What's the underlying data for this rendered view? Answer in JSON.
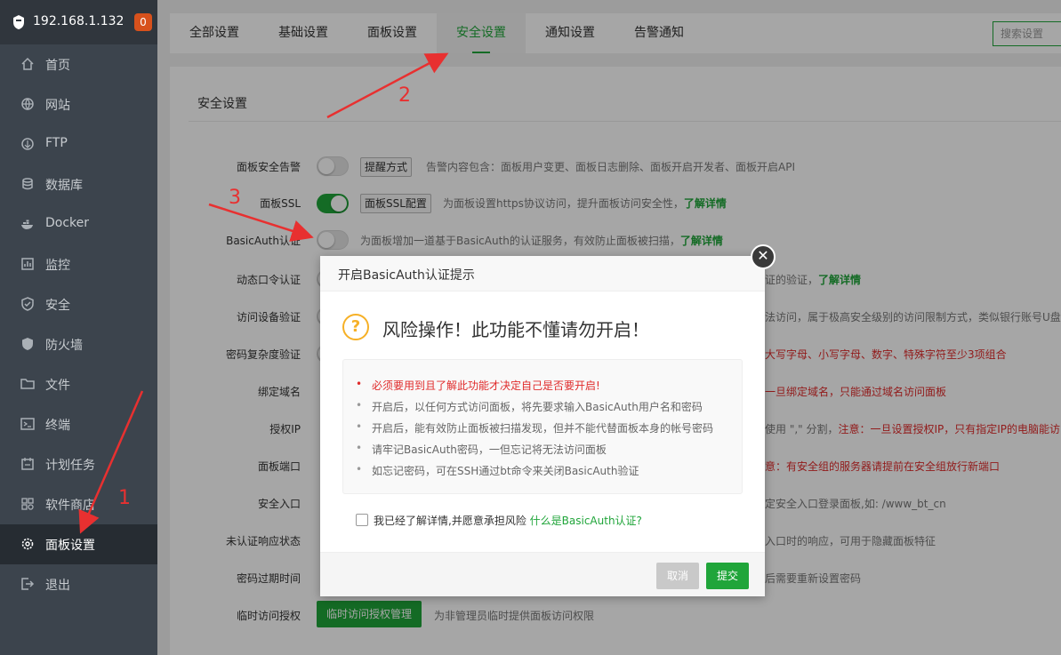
{
  "sidebar": {
    "ip": "192.168.1.132",
    "badge": "0",
    "items": [
      {
        "label": "首页",
        "icon": "home-icon"
      },
      {
        "label": "网站",
        "icon": "globe-icon"
      },
      {
        "label": "FTP",
        "icon": "ftp-icon"
      },
      {
        "label": "数据库",
        "icon": "database-icon"
      },
      {
        "label": "Docker",
        "icon": "docker-icon"
      },
      {
        "label": "监控",
        "icon": "monitor-icon"
      },
      {
        "label": "安全",
        "icon": "shield-icon"
      },
      {
        "label": "防火墙",
        "icon": "firewall-icon"
      },
      {
        "label": "文件",
        "icon": "folder-icon"
      },
      {
        "label": "终端",
        "icon": "terminal-icon"
      },
      {
        "label": "计划任务",
        "icon": "calendar-icon"
      },
      {
        "label": "软件商店",
        "icon": "apps-icon"
      },
      {
        "label": "面板设置",
        "icon": "gear-icon"
      },
      {
        "label": "退出",
        "icon": "logout-icon"
      }
    ]
  },
  "tabs": [
    "全部设置",
    "基础设置",
    "面板设置",
    "安全设置",
    "通知设置",
    "告警通知"
  ],
  "search_placeholder": "搜索设置",
  "section_title": "安全设置",
  "rows": {
    "alert": {
      "label": "面板安全告警",
      "button": "提醒方式",
      "hint": "告警内容包含：面板用户变更、面板日志删除、面板开启开发者、面板开启API"
    },
    "ssl": {
      "label": "面板SSL",
      "button": "面板SSL配置",
      "hint": "为面板设置https协议访问，提升面板访问安全性，",
      "link": "了解详情"
    },
    "basicauth": {
      "label": "BasicAuth认证",
      "hint": "为面板增加一道基于BasicAuth的认证服务，有效防止面板被扫描，",
      "link": "了解详情"
    },
    "dynamic": {
      "label": "动态口令认证",
      "hint": "证的验证，",
      "link": "了解详情"
    },
    "device": {
      "label": "访问设备验证",
      "hint": "法访问，属于极高安全级别的访问限制方式，类似银行账号U盘"
    },
    "password": {
      "label": "密码复杂度验证",
      "hint": "大写字母、小写字母、数字、特殊字符至少3项组合"
    },
    "domain": {
      "label": "绑定域名",
      "hint": "一旦绑定域名，只能通过域名访问面板"
    },
    "ip": {
      "label": "授权IP",
      "hint_a": "使用 \",\" 分割，",
      "hint_b": "注意：一旦设置授权IP，只有指定IP的电脑能访"
    },
    "port": {
      "label": "面板端口",
      "hint": "意：有安全组的服务器请提前在安全组放行新端口"
    },
    "entry": {
      "label": "安全入口",
      "hint": "定安全入口登录面板,如: /www_bt_cn"
    },
    "unauth": {
      "label": "未认证响应状态",
      "hint": "入口时的响应，可用于隐藏面板特征"
    },
    "expire": {
      "label": "密码过期时间",
      "hint": "后需要重新设置密码"
    },
    "temp": {
      "label": "临时访问授权",
      "button": "临时访问授权管理",
      "hint": "为非管理员临时提供面板访问权限"
    }
  },
  "modal": {
    "title": "开启BasicAuth认证提示",
    "warning": "风险操作！此功能不懂请勿开启！",
    "items": [
      "必须要用到且了解此功能才决定自己是否要开启!",
      "开启后，以任何方式访问面板，将先要求输入BasicAuth用户名和密码",
      "开启后，能有效防止面板被扫描发现，但并不能代替面板本身的帐号密码",
      "请牢记BasicAuth密码，一但忘记将无法访问面板",
      "如忘记密码，可在SSH通过bt命令来关闭BasicAuth验证"
    ],
    "checkbox_label": "我已经了解详情,并愿意承担风险",
    "checkbox_link": "什么是BasicAuth认证?",
    "cancel": "取消",
    "submit": "提交"
  },
  "annotations": [
    "1",
    "2",
    "3"
  ]
}
